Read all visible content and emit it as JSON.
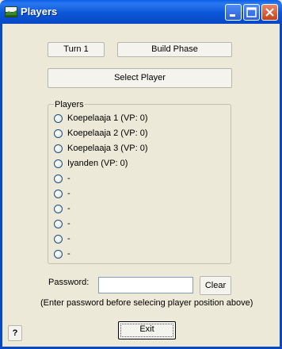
{
  "window": {
    "title": "Players",
    "controls": {
      "minimize": "minimize-icon",
      "maximize": "maximize-icon",
      "close": "close-icon"
    }
  },
  "toolbar": {
    "turn_label": "Turn 1",
    "phase_label": "Build Phase",
    "select_player_label": "Select Player"
  },
  "players": {
    "group_label": "Players",
    "items": [
      {
        "label": "Koepelaaja 1 (VP: 0)"
      },
      {
        "label": "Koepelaaja 2 (VP: 0)"
      },
      {
        "label": "Koepelaaja 3 (VP: 0)"
      },
      {
        "label": "Iyanden (VP: 0)"
      },
      {
        "label": "-"
      },
      {
        "label": "-"
      },
      {
        "label": "-"
      },
      {
        "label": "-"
      },
      {
        "label": "-"
      },
      {
        "label": "-"
      }
    ]
  },
  "password": {
    "label": "Password:",
    "value": "",
    "clear_label": "Clear",
    "hint": "(Enter password before selecing player position above)"
  },
  "footer": {
    "help_label": "?",
    "exit_label": "Exit"
  }
}
